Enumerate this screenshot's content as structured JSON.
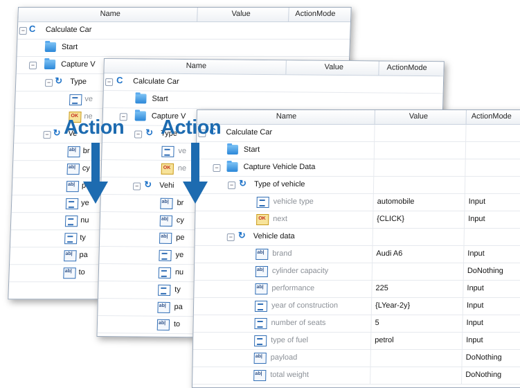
{
  "columns": {
    "name": "Name",
    "value": "Value",
    "mode": "ActionMode"
  },
  "back_panel": {
    "rows": [
      "Calculate Car",
      "Start",
      "Capture V",
      "Type",
      "ve",
      "ne",
      "Ve",
      "br",
      "cy",
      "pe",
      "ye",
      "nu",
      "ty",
      "pa",
      "to"
    ]
  },
  "middle_panel": {
    "rows": [
      "Calculate Car",
      "Start",
      "Capture V",
      "Type",
      "ve",
      "ne",
      "Vehi",
      "br",
      "cy",
      "pe",
      "ye",
      "nu",
      "ty",
      "pa",
      "to"
    ]
  },
  "front_panel": {
    "root": "Calculate Car",
    "start": "Start",
    "capture": "Capture Vehicle Data",
    "type_group": "Type of vehicle",
    "vehicle_type": {
      "label": "vehicle type",
      "value": "automobile",
      "mode": "Input"
    },
    "next": {
      "label": "next",
      "value": "{CLICK}",
      "mode": "Input"
    },
    "vehicle_group": "Vehicle data",
    "brand": {
      "label": "brand",
      "value": "Audi A6",
      "mode": "Input"
    },
    "cylinder": {
      "label": "cylinder capacity",
      "value": "",
      "mode": "DoNothing"
    },
    "performance": {
      "label": "performance",
      "value": "225",
      "mode": "Input"
    },
    "year": {
      "label": "year of construction",
      "value": "{LYear-2y}",
      "mode": "Input"
    },
    "seats": {
      "label": "number of seats",
      "value": "5",
      "mode": "Input"
    },
    "fuel": {
      "label": "type of fuel",
      "value": "petrol",
      "mode": "Input"
    },
    "payload": {
      "label": "payload",
      "value": "",
      "mode": "DoNothing"
    },
    "total_weight": {
      "label": "total weight",
      "value": "",
      "mode": "DoNothing"
    }
  },
  "overlay": {
    "action_left": "Action",
    "action_right": "Action"
  },
  "colors": {
    "accent": "#1d6bb0",
    "loop_icon": "#1f73c8"
  }
}
